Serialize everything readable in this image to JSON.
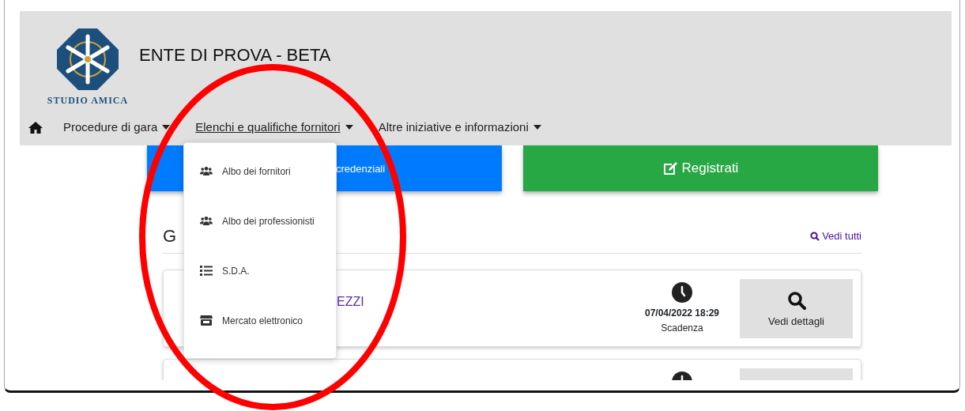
{
  "header": {
    "logo_text": "STUDIO AMICA",
    "title": "ENTE DI PROVA - BETA"
  },
  "nav": [
    {
      "label": "Procedure di gara",
      "dropdown": true,
      "selected": false
    },
    {
      "label": "Elenchi e qualifiche fornitori",
      "dropdown": true,
      "selected": true
    },
    {
      "label": "Altre iniziative e informazioni",
      "dropdown": true,
      "selected": false
    }
  ],
  "dropdown_menu": [
    {
      "kind": "group",
      "label": "Albo dei fornitori"
    },
    {
      "kind": "group",
      "label": "Albo dei professionisti"
    },
    {
      "kind": "list",
      "label": "S.D.A."
    },
    {
      "kind": "store",
      "label": "Mercato elettronico"
    }
  ],
  "actions": [
    {
      "kind": "primary",
      "label": "credenziali"
    },
    {
      "kind": "success",
      "label": "Registrati"
    }
  ],
  "section": {
    "title": "G",
    "view_all": "Vedi tutti"
  },
  "cards": [
    {
      "kind": "full",
      "title": "EZZI",
      "deadline": "07/04/2022 18:29",
      "deadline_label": "Scadenza",
      "button": "Vedi dettagli"
    },
    {
      "kind": "cut"
    }
  ],
  "annotations": [
    {
      "kind": "ellipse"
    }
  ]
}
